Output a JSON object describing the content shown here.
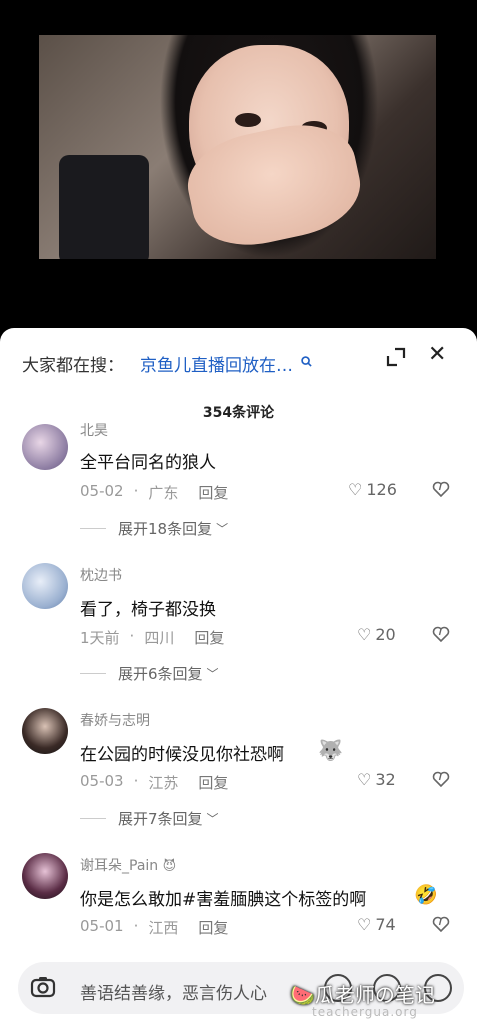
{
  "search": {
    "label": "大家都在搜：",
    "query": "京鱼儿直播回放在…",
    "icon": "search-icon"
  },
  "comment_count": "354条评论",
  "comments": [
    {
      "username": "北昊",
      "text": "全平台同名的狼人",
      "date": "05-02",
      "location": "广东",
      "reply_label": "回复",
      "likes": "126",
      "expand": "展开18条回复"
    },
    {
      "username": "枕边书",
      "text": "看了，椅子都没换",
      "date": "1天前",
      "location": "四川",
      "reply_label": "回复",
      "likes": "20",
      "expand": "展开6条回复"
    },
    {
      "username": "春娇与志明",
      "text": "在公园的时候没见你社恐啊",
      "date": "05-03",
      "location": "江苏",
      "reply_label": "回复",
      "likes": "32",
      "expand": "展开7条回复"
    },
    {
      "username": "谢耳朵_Pain",
      "text": "你是怎么敢加#害羞腼腆这个标签的啊",
      "date": "05-01",
      "location": "江西",
      "reply_label": "回复",
      "likes": "74"
    }
  ],
  "input": {
    "placeholder": "善语结善缘，恶言伤人心"
  },
  "watermark": {
    "text": "瓜老师の笔记",
    "url": "teachergua.org"
  },
  "colors": {
    "accent": "#1f5fc4",
    "background": "#ffffff"
  }
}
